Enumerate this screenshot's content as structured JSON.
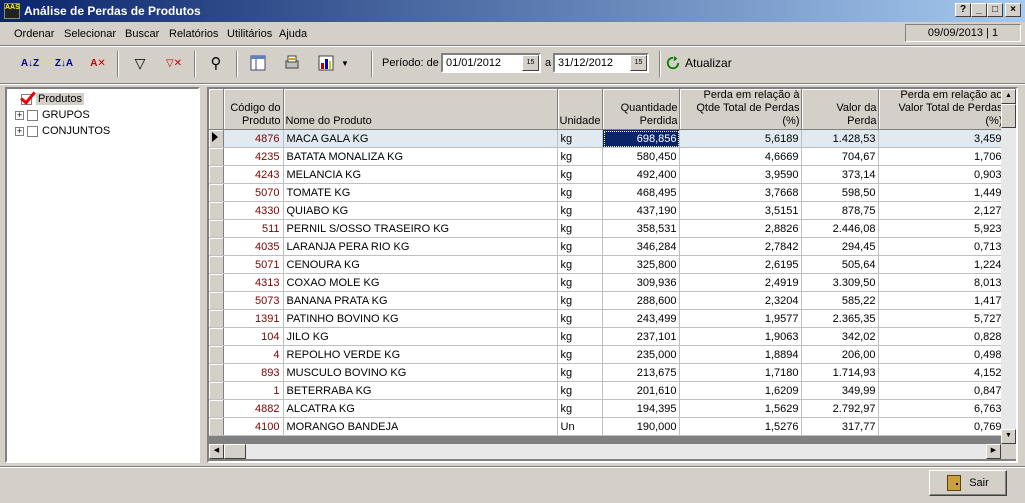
{
  "window": {
    "title": "Análise de Perdas de Produtos",
    "icon_text": "AAS",
    "buttons": {
      "help": "?",
      "minimize": "_",
      "maximize": "□",
      "close": "×"
    }
  },
  "menu": [
    {
      "label": "Ordenar"
    },
    {
      "label": "Selecionar"
    },
    {
      "label": "Buscar"
    },
    {
      "label": "Relatórios"
    },
    {
      "label": "Utilitários"
    },
    {
      "label": "Ajuda"
    }
  ],
  "date_status": "09/09/2013 | 1",
  "toolbar": {
    "sort_asc": "A↓Z",
    "sort_desc": "Z↓A",
    "clear_sort": "A✕",
    "filter": "▽",
    "clear_filter": "▽✕",
    "search": "⚲",
    "period_label": "Período: de",
    "date_from": "01/01/2012",
    "date_to": "31/12/2012",
    "to_label": "a",
    "cal_label": "15",
    "refresh_label": "Atualizar"
  },
  "tree": {
    "root": "Produtos",
    "children": [
      {
        "label": "GRUPOS"
      },
      {
        "label": "CONJUNTOS"
      }
    ]
  },
  "columns": {
    "code": "Código do Produto",
    "name": "Nome do Produto",
    "unit": "Unidade",
    "qty": "Quantidade Perdida",
    "pct_qty": "Perda em relação à Qtde Total de Perdas (%)",
    "value": "Valor da Perda",
    "pct_value": "Perda em relação ao Valor Total de Perdas (%)"
  },
  "rows": [
    {
      "code": "4876",
      "name": "MACA GALA KG",
      "unit": "kg",
      "qty": "698,856",
      "pct_qty": "5,6189",
      "value": "1.428,53",
      "pct_value": "3,459"
    },
    {
      "code": "4235",
      "name": "BATATA MONALIZA KG",
      "unit": "kg",
      "qty": "580,450",
      "pct_qty": "4,6669",
      "value": "704,67",
      "pct_value": "1,706"
    },
    {
      "code": "4243",
      "name": "MELANCIA KG",
      "unit": "kg",
      "qty": "492,400",
      "pct_qty": "3,9590",
      "value": "373,14",
      "pct_value": "0,903"
    },
    {
      "code": "5070",
      "name": "TOMATE KG",
      "unit": "kg",
      "qty": "468,495",
      "pct_qty": "3,7668",
      "value": "598,50",
      "pct_value": "1,449"
    },
    {
      "code": "4330",
      "name": "QUIABO KG",
      "unit": "kg",
      "qty": "437,190",
      "pct_qty": "3,5151",
      "value": "878,75",
      "pct_value": "2,127"
    },
    {
      "code": "511",
      "name": "PERNIL S/OSSO TRASEIRO KG",
      "unit": "kg",
      "qty": "358,531",
      "pct_qty": "2,8826",
      "value": "2.446,08",
      "pct_value": "5,923"
    },
    {
      "code": "4035",
      "name": "LARANJA PERA RIO KG",
      "unit": "kg",
      "qty": "346,284",
      "pct_qty": "2,7842",
      "value": "294,45",
      "pct_value": "0,713"
    },
    {
      "code": "5071",
      "name": "CENOURA KG",
      "unit": "kg",
      "qty": "325,800",
      "pct_qty": "2,6195",
      "value": "505,64",
      "pct_value": "1,224"
    },
    {
      "code": "4313",
      "name": "COXAO MOLE KG",
      "unit": "kg",
      "qty": "309,936",
      "pct_qty": "2,4919",
      "value": "3.309,50",
      "pct_value": "8,013"
    },
    {
      "code": "5073",
      "name": "BANANA PRATA KG",
      "unit": "kg",
      "qty": "288,600",
      "pct_qty": "2,3204",
      "value": "585,22",
      "pct_value": "1,417"
    },
    {
      "code": "1391",
      "name": "PATINHO BOVINO KG",
      "unit": "kg",
      "qty": "243,499",
      "pct_qty": "1,9577",
      "value": "2.365,35",
      "pct_value": "5,727"
    },
    {
      "code": "104",
      "name": "JILO KG",
      "unit": "kg",
      "qty": "237,101",
      "pct_qty": "1,9063",
      "value": "342,02",
      "pct_value": "0,828"
    },
    {
      "code": "4",
      "name": "REPOLHO VERDE KG",
      "unit": "kg",
      "qty": "235,000",
      "pct_qty": "1,8894",
      "value": "206,00",
      "pct_value": "0,498"
    },
    {
      "code": "893",
      "name": "MUSCULO BOVINO KG",
      "unit": "kg",
      "qty": "213,675",
      "pct_qty": "1,7180",
      "value": "1.714,93",
      "pct_value": "4,152"
    },
    {
      "code": "1",
      "name": "BETERRABA KG",
      "unit": "kg",
      "qty": "201,610",
      "pct_qty": "1,6209",
      "value": "349,99",
      "pct_value": "0,847"
    },
    {
      "code": "4882",
      "name": "ALCATRA KG",
      "unit": "kg",
      "qty": "194,395",
      "pct_qty": "1,5629",
      "value": "2.792,97",
      "pct_value": "6,763"
    },
    {
      "code": "4100",
      "name": "MORANGO BANDEJA",
      "unit": "Un",
      "qty": "190,000",
      "pct_qty": "1,5276",
      "value": "317,77",
      "pct_value": "0,769"
    }
  ],
  "footer": {
    "exit_label": "Sair"
  }
}
